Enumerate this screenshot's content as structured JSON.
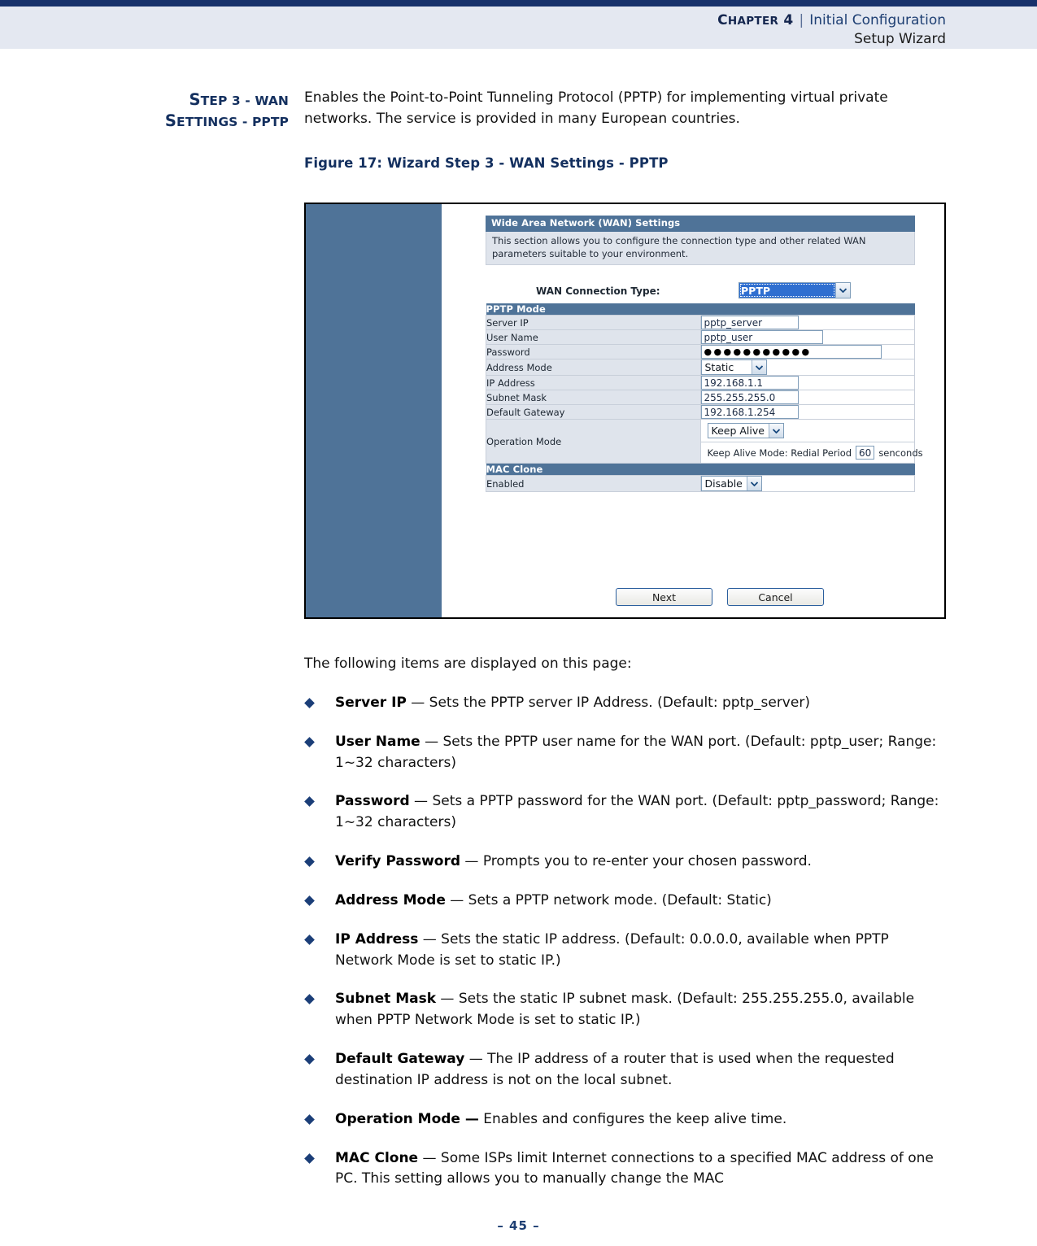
{
  "header": {
    "chapter_label": "Chapter 4",
    "chapter_word_c": "C",
    "chapter_word_rest": "HAPTER",
    "chapter_number": "4",
    "separator": "|",
    "section": "Initial Configuration",
    "subsection": "Setup Wizard"
  },
  "side_heading": {
    "line1_cap": "S",
    "line1_rest": "TEP 3 - WAN",
    "line2_cap": "S",
    "line2_rest": "ETTINGS - PPTP",
    "full": "STEP 3 - WAN SETTINGS - PPTP"
  },
  "intro_paragraph": "Enables the Point-to-Point Tunneling Protocol (PPTP) for implementing virtual private networks. The service is provided in many European countries.",
  "figure_caption": "Figure 17:  Wizard Step 3 - WAN Settings - PPTP",
  "screenshot": {
    "wan_section": {
      "title": "Wide Area Network (WAN) Settings",
      "description": "This section allows you to configure the connection type and other related WAN parameters suitable to your environment."
    },
    "wan_connection_type": {
      "label": "WAN Connection Type:",
      "value": "PPTP"
    },
    "pptp_section_title": "PPTP Mode",
    "fields": [
      {
        "label": "Server IP",
        "value": "pptp_server",
        "type": "text"
      },
      {
        "label": "User Name",
        "value": "pptp_user",
        "type": "text"
      },
      {
        "label": "Password",
        "value": "●●●●●●●●●●●",
        "type": "password"
      },
      {
        "label": "Address Mode",
        "value": "Static",
        "type": "select"
      },
      {
        "label": "IP Address",
        "value": "192.168.1.1",
        "type": "text"
      },
      {
        "label": "Subnet Mask",
        "value": "255.255.255.0",
        "type": "text"
      },
      {
        "label": "Default Gateway",
        "value": "192.168.1.254",
        "type": "text"
      }
    ],
    "operation_mode": {
      "label": "Operation Mode",
      "value": "Keep Alive",
      "sub_prefix": "Keep Alive Mode: Redial Period",
      "sub_value": "60",
      "sub_suffix": "senconds"
    },
    "mac_clone_section_title": "MAC Clone",
    "mac_clone": {
      "label": "Enabled",
      "value": "Disable"
    },
    "buttons": {
      "next": "Next",
      "cancel": "Cancel"
    }
  },
  "items_intro": "The following items are displayed on this page:",
  "bullets": [
    {
      "term": "Server IP",
      "dash": " — ",
      "text": "Sets the PPTP server IP Address. (Default: pptp_server)"
    },
    {
      "term": "User Name",
      "dash": " — ",
      "text": "Sets the PPTP user name for the WAN port. (Default: pptp_user; Range: 1~32 characters)"
    },
    {
      "term": "Password",
      "dash": " — ",
      "text": "Sets a PPTP password for the WAN port. (Default: pptp_password; Range: 1~32 characters)"
    },
    {
      "term": "Verify Password",
      "dash": " — ",
      "text": "Prompts you to re-enter your chosen password."
    },
    {
      "term": "Address Mode",
      "dash": " — ",
      "text": "Sets a PPTP network mode. (Default: Static)"
    },
    {
      "term": "IP Address",
      "dash": " — ",
      "text": "Sets the static IP address. (Default: 0.0.0.0, available when PPTP Network Mode is set to static IP.)"
    },
    {
      "term": "Subnet Mask",
      "dash": " — ",
      "text": "Sets the static IP subnet mask. (Default: 255.255.255.0, available when PPTP Network Mode is set to static IP.)"
    },
    {
      "term": "Default Gateway",
      "dash": " — ",
      "text": "The IP address of a router that is used when the requested destination IP address is not on the local subnet."
    },
    {
      "term": "Operation Mode —",
      "dash": " ",
      "text": "Enables and configures the keep alive time."
    },
    {
      "term": "MAC Clone",
      "dash": " — ",
      "text": "Some ISPs limit Internet connections to a specified MAC address of one PC. This setting allows you to manually change the MAC"
    }
  ],
  "page_number": "–  45  –",
  "colors": {
    "header_rule": "#17316b",
    "header_band": "#e4e8f1",
    "heading_navy": "#14305f",
    "ui_steel_blue": "#4f7398",
    "ui_label_cell": "#dfe4ec",
    "select_highlight": "#2f6fd0"
  }
}
